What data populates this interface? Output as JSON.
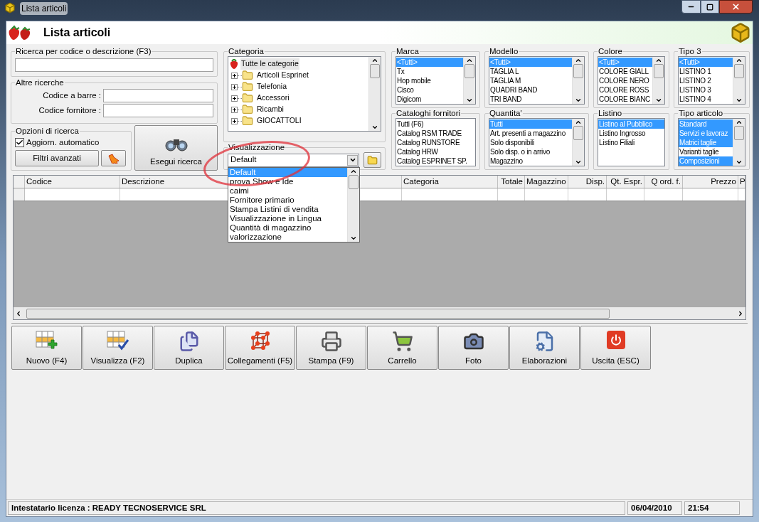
{
  "window": {
    "title": "Lista articoli"
  },
  "header": {
    "title": "Lista articoli"
  },
  "search": {
    "label": "Ricerca per codice o descrizione (F3)"
  },
  "other_searches": {
    "label": "Altre ricerche",
    "fields": [
      {
        "label": "Codice a barre :"
      },
      {
        "label": "Codice fornitore :"
      }
    ]
  },
  "search_options": {
    "label": "Opzioni di ricerca",
    "auto_update": {
      "label": "Aggiorn. automatico",
      "checked": true
    },
    "advanced_filters": "Filtri avanzati"
  },
  "run_search": "Esegui ricerca",
  "category": {
    "label": "Categoria",
    "tree": [
      {
        "label": "Tutte le categorie",
        "kind": "root",
        "selected": true,
        "children": [
          {
            "label": "Articoli Esprinet",
            "kind": "folder",
            "expanded": false,
            "selected": false
          },
          {
            "label": "Telefonia",
            "kind": "folder",
            "expanded": false,
            "selected": false
          },
          {
            "label": "Accessori",
            "kind": "folder",
            "expanded": false,
            "selected": false
          },
          {
            "label": "Ricambi",
            "kind": "folder",
            "expanded": false,
            "selected": false
          },
          {
            "label": "GIOCATTOLI",
            "kind": "folder",
            "expanded": false,
            "selected": false
          }
        ]
      }
    ]
  },
  "view": {
    "label": "Visualizzazione",
    "value": "Default",
    "expanded": true,
    "options": [
      {
        "label": "Default",
        "selected": true
      },
      {
        "label": "prova Show e Ide",
        "selected": false
      },
      {
        "label": "caimi",
        "selected": false
      },
      {
        "label": "Fornitore primario",
        "selected": false
      },
      {
        "label": "Stampa Listini di vendita",
        "selected": false
      },
      {
        "label": "Visualizzazione in Lingua",
        "selected": false
      },
      {
        "label": "Quantità di magazzino",
        "selected": false
      },
      {
        "label": "valorizzazione",
        "selected": false
      }
    ]
  },
  "filters": [
    {
      "label": "Marca",
      "items": [
        {
          "label": "<Tutti>",
          "selected": true
        },
        {
          "label": "Tx",
          "selected": false
        },
        {
          "label": "Hop mobile",
          "selected": false
        },
        {
          "label": "Cisco",
          "selected": false
        },
        {
          "label": "Digicom",
          "selected": false
        }
      ]
    },
    {
      "label": "Modello",
      "items": [
        {
          "label": "<Tutti>",
          "selected": true
        },
        {
          "label": "TAGLIA L",
          "selected": false
        },
        {
          "label": "TAGLIA M",
          "selected": false
        },
        {
          "label": "QUADRI BAND",
          "selected": false
        },
        {
          "label": "TRI BAND",
          "selected": false
        }
      ]
    },
    {
      "label": "Colore",
      "items": [
        {
          "label": "<Tutti>",
          "selected": true
        },
        {
          "label": "COLORE GIALL",
          "selected": false
        },
        {
          "label": "COLORE NERO",
          "selected": false
        },
        {
          "label": "COLORE ROSS",
          "selected": false
        },
        {
          "label": "COLORE BIANC",
          "selected": false
        }
      ]
    },
    {
      "label": "Tipo 3",
      "items": [
        {
          "label": "<Tutti>",
          "selected": true
        },
        {
          "label": "LISTINO 1",
          "selected": false
        },
        {
          "label": "LISTINO 2",
          "selected": false
        },
        {
          "label": "LISTINO 3",
          "selected": false
        },
        {
          "label": "LISTINO 4",
          "selected": false
        }
      ]
    },
    {
      "label": "Cataloghi fornitori",
      "items": [
        {
          "label": "Tutti (F6)",
          "selected": false
        },
        {
          "label": "Catalog RSM TRADE",
          "selected": false
        },
        {
          "label": "Catalog RUNSTORE",
          "selected": false
        },
        {
          "label": "Catalog HRW",
          "selected": false
        },
        {
          "label": "Catalog ESPRINET SP.",
          "selected": false
        }
      ]
    },
    {
      "label": "Quantita'",
      "items": [
        {
          "label": "Tutti",
          "selected": true
        },
        {
          "label": "Art. presenti a magazzino",
          "selected": false
        },
        {
          "label": "Solo disponibili",
          "selected": false
        },
        {
          "label": "Solo disp. o in arrivo",
          "selected": false
        },
        {
          "label": "Magazzino",
          "selected": false
        }
      ]
    },
    {
      "label": "Listino",
      "items": [
        {
          "label": "Listino al Pubblico",
          "selected": true
        },
        {
          "label": "Listino Ingrosso",
          "selected": false
        },
        {
          "label": "Listino Filiali",
          "selected": false
        }
      ]
    },
    {
      "label": "Tipo articolo",
      "items": [
        {
          "label": "Standard",
          "selected": true
        },
        {
          "label": "Servizi e lavoraz",
          "selected": true
        },
        {
          "label": "Matrici taglie",
          "selected": true
        },
        {
          "label": "Varianti taglie",
          "selected": false
        },
        {
          "label": "Composizioni",
          "selected": true
        }
      ]
    }
  ],
  "grid": {
    "columns": [
      {
        "label": "Codice",
        "kind": "text"
      },
      {
        "label": "Descrizione",
        "kind": "text"
      },
      {
        "label": "Categoria",
        "kind": "text"
      },
      {
        "label": "Totale",
        "kind": "number"
      },
      {
        "label": "Magazzino",
        "kind": "text"
      },
      {
        "label": "Disp.",
        "kind": "number"
      },
      {
        "label": "Qt. Espr.",
        "kind": "number"
      },
      {
        "label": "Q ord. f.",
        "kind": "number"
      },
      {
        "label": "Prezzo",
        "kind": "number"
      },
      {
        "label": "P",
        "kind": "text"
      }
    ]
  },
  "toolbar": [
    {
      "label": "Nuovo (F4)",
      "kind": "new"
    },
    {
      "label": "Visualizza (F2)",
      "kind": "view"
    },
    {
      "label": "Duplica",
      "kind": "duplicate"
    },
    {
      "label": "Collegamenti (F5)",
      "kind": "links"
    },
    {
      "label": "Stampa (F9)",
      "kind": "print"
    },
    {
      "label": "Carrello",
      "kind": "cart"
    },
    {
      "label": "Foto",
      "kind": "photo"
    },
    {
      "label": "Elaborazioni",
      "kind": "process"
    },
    {
      "label": "Uscita (ESC)",
      "kind": "exit"
    }
  ],
  "status_bar": {
    "license": "Intestatario licenza : READY TECNOSERVICE SRL",
    "date": "06/04/2010",
    "time": "21:54"
  }
}
